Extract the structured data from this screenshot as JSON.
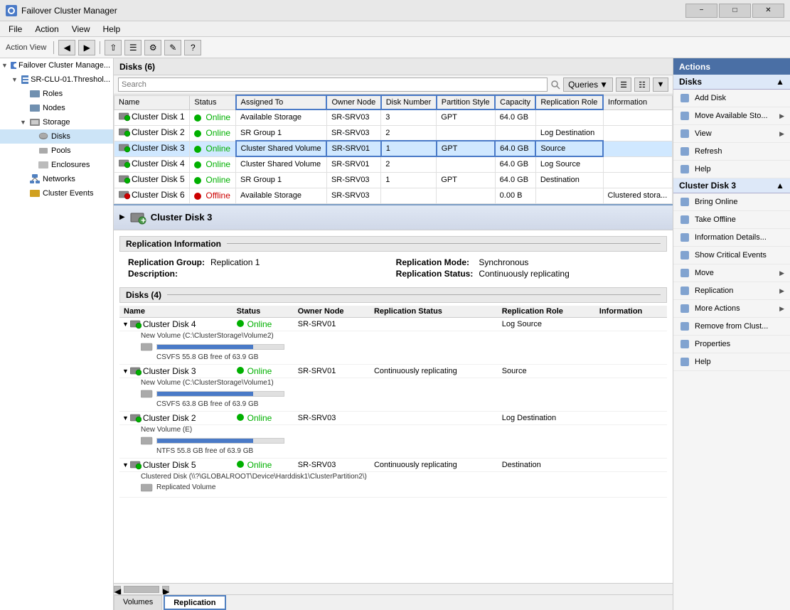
{
  "app": {
    "title": "Failover Cluster Manager",
    "menu": [
      "File",
      "Action",
      "View",
      "Help"
    ]
  },
  "sidebar": {
    "action_view_label": "Action View",
    "items": [
      {
        "id": "root",
        "label": "Failover Cluster Manage...",
        "level": 0,
        "expanded": true
      },
      {
        "id": "cluster",
        "label": "SR-CLU-01.Threshol...",
        "level": 1,
        "expanded": true
      },
      {
        "id": "roles",
        "label": "Roles",
        "level": 2
      },
      {
        "id": "nodes",
        "label": "Nodes",
        "level": 2
      },
      {
        "id": "storage",
        "label": "Storage",
        "level": 2,
        "expanded": true
      },
      {
        "id": "disks",
        "label": "Disks",
        "level": 3,
        "selected": true
      },
      {
        "id": "pools",
        "label": "Pools",
        "level": 3
      },
      {
        "id": "enclosures",
        "label": "Enclosures",
        "level": 3
      },
      {
        "id": "networks",
        "label": "Networks",
        "level": 2
      },
      {
        "id": "cluster-events",
        "label": "Cluster Events",
        "level": 2
      }
    ]
  },
  "main": {
    "panel_title": "Disks (6)",
    "search_placeholder": "Search",
    "queries_label": "Queries",
    "table": {
      "columns": [
        "Name",
        "Status",
        "Assigned To",
        "Owner Node",
        "Disk Number",
        "Partition Style",
        "Capacity",
        "Replication Role",
        "Information"
      ],
      "rows": [
        {
          "name": "Cluster Disk 1",
          "status": "Online",
          "status_type": "online",
          "assigned": "Available Storage",
          "owner": "SR-SRV03",
          "disk_num": "3",
          "partition": "GPT",
          "capacity": "64.0 GB",
          "rep_role": "",
          "info": "",
          "highlighted": false
        },
        {
          "name": "Cluster Disk 2",
          "status": "Online",
          "status_type": "online",
          "assigned": "SR Group 1",
          "owner": "SR-SRV03",
          "disk_num": "2",
          "partition": "",
          "capacity": "",
          "rep_role": "Log Destination",
          "info": "",
          "highlighted": false
        },
        {
          "name": "Cluster Disk 3",
          "status": "Online",
          "status_type": "online",
          "assigned": "Cluster Shared Volume",
          "owner": "SR-SRV01",
          "disk_num": "1",
          "partition": "GPT",
          "capacity": "64.0 GB",
          "rep_role": "Source",
          "info": "",
          "highlighted": true
        },
        {
          "name": "Cluster Disk 4",
          "status": "Online",
          "status_type": "online",
          "assigned": "Cluster Shared Volume",
          "owner": "SR-SRV01",
          "disk_num": "2",
          "partition": "",
          "capacity": "64.0 GB",
          "rep_role": "Log Source",
          "info": "",
          "highlighted": false
        },
        {
          "name": "Cluster Disk 5",
          "status": "Online",
          "status_type": "online",
          "assigned": "SR Group 1",
          "owner": "SR-SRV03",
          "disk_num": "1",
          "partition": "GPT",
          "capacity": "64.0 GB",
          "rep_role": "Destination",
          "info": "",
          "highlighted": false
        },
        {
          "name": "Cluster Disk 6",
          "status": "Offline",
          "status_type": "offline",
          "assigned": "Available Storage",
          "owner": "SR-SRV03",
          "disk_num": "",
          "partition": "",
          "capacity": "0.00 B",
          "rep_role": "",
          "info": "Clustered stora...",
          "highlighted": false
        }
      ]
    },
    "detail": {
      "disk_name": "Cluster Disk 3",
      "replication_section": "Replication Information",
      "rep_group_label": "Replication Group:",
      "rep_group_value": "Replication 1",
      "rep_mode_label": "Replication Mode:",
      "rep_mode_value": "Synchronous",
      "desc_label": "Description:",
      "desc_value": "",
      "rep_status_label": "Replication Status:",
      "rep_status_value": "Continuously replicating",
      "disks_section": "Disks (4)",
      "disk_columns": [
        "Name",
        "Status",
        "Owner Node",
        "Replication Status",
        "Replication Role",
        "Information"
      ],
      "disk_rows": [
        {
          "name": "Cluster Disk 4",
          "status": "Online",
          "status_type": "online",
          "owner": "SR-SRV01",
          "rep_status": "",
          "rep_role": "Log Source",
          "info": "",
          "sub_items": [
            {
              "volume_label": "New Volume (C:\\ClusterStorage\\Volume2)",
              "bar_pct": 75,
              "fs_info": "CSVFS 55.8 GB free of 63.9 GB"
            }
          ]
        },
        {
          "name": "Cluster Disk 3",
          "status": "Online",
          "status_type": "online",
          "owner": "SR-SRV01",
          "rep_status": "Continuously replicating",
          "rep_role": "Source",
          "info": "",
          "sub_items": [
            {
              "volume_label": "New Volume (C:\\ClusterStorage\\Volume1)",
              "bar_pct": 75,
              "fs_info": "CSVFS 63.8 GB free of 63.9 GB"
            }
          ]
        },
        {
          "name": "Cluster Disk 2",
          "status": "Online",
          "status_type": "online",
          "owner": "SR-SRV03",
          "rep_status": "",
          "rep_role": "Log Destination",
          "info": "",
          "sub_items": [
            {
              "volume_label": "New Volume (E)",
              "bar_pct": 75,
              "fs_info": "NTFS 55.8 GB free of 63.9 GB"
            }
          ]
        },
        {
          "name": "Cluster Disk 5",
          "status": "Online",
          "status_type": "online",
          "owner": "SR-SRV03",
          "rep_status": "Continuously replicating",
          "rep_role": "Destination",
          "info": "",
          "sub_items": [
            {
              "volume_label": "Clustered Disk (\\\\?\\GLOBALROOT\\Device\\Harddisk1\\ClusterPartition2\\)",
              "bar_pct": 0,
              "fs_info": "Replicated Volume"
            }
          ]
        }
      ]
    },
    "tabs": [
      "Volumes",
      "Replication"
    ]
  },
  "actions": {
    "panel_title": "Actions",
    "disks_section": "Disks",
    "disks_items": [
      {
        "label": "Add Disk",
        "has_arrow": false
      },
      {
        "label": "Move Available Sto...",
        "has_arrow": true
      },
      {
        "label": "View",
        "has_arrow": true
      },
      {
        "label": "Refresh",
        "has_arrow": false
      },
      {
        "label": "Help",
        "has_arrow": false
      }
    ],
    "disk3_section": "Cluster Disk 3",
    "disk3_items": [
      {
        "label": "Bring Online",
        "has_arrow": false
      },
      {
        "label": "Take Offline",
        "has_arrow": false
      },
      {
        "label": "Information Details...",
        "has_arrow": false
      },
      {
        "label": "Show Critical Events",
        "has_arrow": false
      },
      {
        "label": "Move",
        "has_arrow": true
      },
      {
        "label": "Replication",
        "has_arrow": true
      },
      {
        "label": "More Actions",
        "has_arrow": true
      },
      {
        "label": "Remove from Clust...",
        "has_arrow": false
      },
      {
        "label": "Properties",
        "has_arrow": false
      },
      {
        "label": "Help",
        "has_arrow": false
      }
    ]
  }
}
